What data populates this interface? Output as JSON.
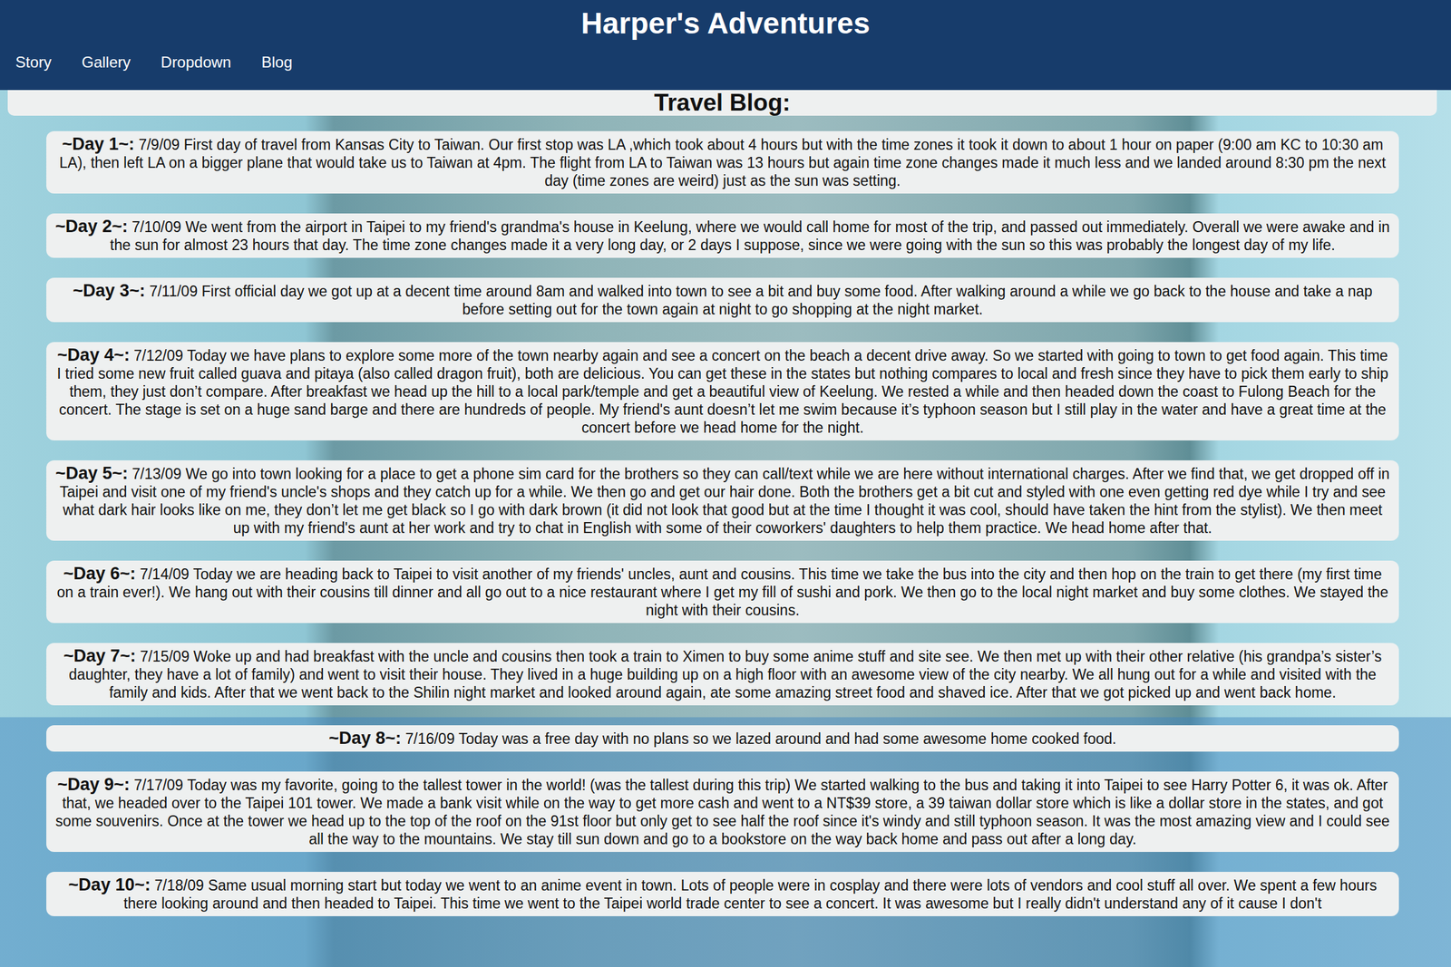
{
  "header": {
    "title": "Harper's Adventures"
  },
  "nav": [
    {
      "label": "Story"
    },
    {
      "label": "Gallery"
    },
    {
      "label": "Dropdown"
    },
    {
      "label": "Blog"
    }
  ],
  "blog": {
    "heading": "Travel Blog:",
    "entries": [
      {
        "day": "~Day 1~:",
        "text": "7/9/09 First day of travel from Kansas City to Taiwan. Our first stop was LA ,which took about 4 hours but with the time zones it took it down to about 1 hour on paper (9:00 am KC to 10:30 am LA), then left LA on a bigger plane that would take us to Taiwan at 4pm. The flight from LA to Taiwan was 13 hours but again time zone changes made it much less and we landed around 8:30 pm the next day (time zones are weird) just as the sun was setting."
      },
      {
        "day": "~Day 2~:",
        "text": "7/10/09 We went from the airport in Taipei to my friend's grandma's house in Keelung, where we would call home for most of the trip, and passed out immediately. Overall we were awake and in the sun for almost 23 hours that day. The time zone changes made it a very long day, or 2 days I suppose, since we were going with the sun so this was probably the longest day of my life."
      },
      {
        "day": "~Day 3~:",
        "text": "7/11/09 First official day we got up at a decent time around 8am and walked into town to see a bit and buy some food. After walking around a while we go back to the house and take a nap before setting out for the town again at night to go shopping at the night market."
      },
      {
        "day": "~Day 4~:",
        "text": "7/12/09 Today we have plans to explore some more of the town nearby again and see a concert on the beach a decent drive away. So we started with going to town to get food again. This time I tried some new fruit called guava and pitaya (also called dragon fruit), both are delicious. You can get these in the states but nothing compares to local and fresh since they have to pick them early to ship them, they just don’t compare. After breakfast we head up the hill to a local park/temple and get a beautiful view of Keelung. We rested a while and then headed down the coast to Fulong Beach for the concert. The stage is set on a huge sand barge and there are hundreds of people. My friend's aunt doesn’t let me swim because it’s typhoon season but I still play in the water and have a great time at the concert before we head home for the night."
      },
      {
        "day": "~Day 5~:",
        "text": "7/13/09 We go into town looking for a place to get a phone sim card for the brothers so they can call/text while we are here without international charges. After we find that, we get dropped off in Taipei and visit one of my friend's uncle's shops and they catch up for a while. We then go and get our hair done. Both the brothers get a bit cut and styled with one even getting red dye while I try and see what dark hair looks like on me, they don’t let me get black so I go with dark brown (it did not look that good but at the time I thought it was cool, should have taken the hint from the stylist). We then meet up with my friend's aunt at her work and try to chat in English with some of their coworkers' daughters to help them practice. We head home after that."
      },
      {
        "day": "~Day 6~:",
        "text": "7/14/09 Today we are heading back to Taipei to visit another of my friends' uncles, aunt and cousins. This time we take the bus into the city and then hop on the train to get there (my first time on a train ever!). We hang out with their cousins till dinner and all go out to a nice restaurant where I get my fill of sushi and pork. We then go to the local night market and buy some clothes. We stayed the night with their cousins."
      },
      {
        "day": "~Day 7~:",
        "text": "7/15/09 Woke up and had breakfast with the uncle and cousins then took a train to Ximen to buy some anime stuff and site see. We then met up with their other relative (his grandpa’s sister’s daughter, they have a lot of family) and went to visit their house. They lived in a huge building up on a high floor with an awesome view of the city nearby. We all hung out for a while and visited with the family and kids. After that we went back to the Shilin night market and looked around again, ate some amazing street food and shaved ice. After that we got picked up and went back home."
      },
      {
        "day": "~Day 8~:",
        "text": "7/16/09 Today was a free day with no plans so we lazed around and had some awesome home cooked food."
      },
      {
        "day": "~Day 9~:",
        "text": "7/17/09 Today was my favorite, going to the tallest tower in the world! (was the tallest during this trip) We started walking to the bus and taking it into Taipei to see Harry Potter 6, it was ok. After that, we headed over to the Taipei 101 tower. We made a bank visit while on the way to get more cash and went to a NT$39 store, a 39 taiwan dollar store which is like a dollar store in the states, and got some souvenirs. Once at the tower we head up to the top of the roof on the 91st floor but only get to see half the roof since it's windy and still typhoon season. It was the most amazing view and I could see all the way to the mountains. We stay till sun down and go to a bookstore on the way back home and pass out after a long day."
      },
      {
        "day": "~Day 10~:",
        "text": "7/18/09 Same usual morning start but today we went to an anime event in town. Lots of people were in cosplay and there were lots of vendors and cool stuff all over. We spent a few hours there looking around and then headed to Taipei. This time we went to the Taipei world trade center to see a concert. It was awesome but I really didn't understand any of it cause I don't"
      }
    ]
  }
}
